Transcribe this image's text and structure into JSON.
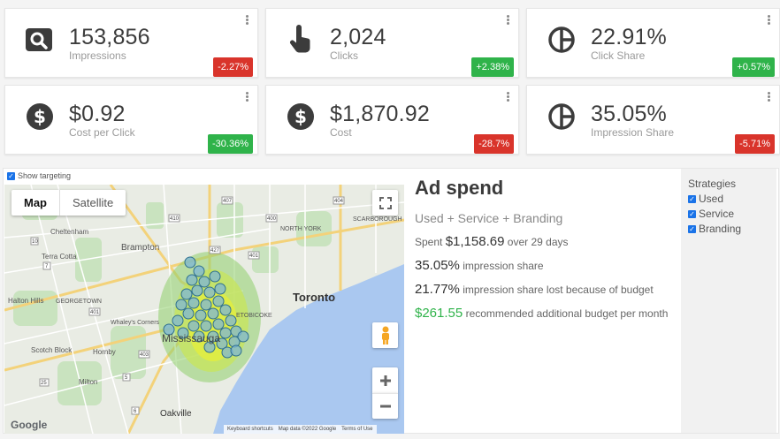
{
  "colors": {
    "negative": "#d9342b",
    "positive": "#2fb34a",
    "icon": "#3c3c3c",
    "water": "#aac8f0",
    "heat_inner": "#e3ee3d",
    "heat_outer": "#8fd06b",
    "bubble": "#7db6d6"
  },
  "metrics": [
    {
      "icon": "search-icon",
      "value": "153,856",
      "label": "Impressions",
      "change": "-2.27%",
      "trend": "negative"
    },
    {
      "icon": "pointer-hand-icon",
      "value": "2,024",
      "label": "Clicks",
      "change": "+2.38%",
      "trend": "positive"
    },
    {
      "icon": "pie-chart-icon",
      "value": "22.91%",
      "label": "Click Share",
      "change": "+0.57%",
      "trend": "positive"
    },
    {
      "icon": "dollar-icon",
      "value": "$0.92",
      "label": "Cost per Click",
      "change": "-30.36%",
      "trend": "positive"
    },
    {
      "icon": "dollar-icon",
      "value": "$1,870.92",
      "label": "Cost",
      "change": "-28.7%",
      "trend": "negative"
    },
    {
      "icon": "pie-chart-icon",
      "value": "35.05%",
      "label": "Impression Share",
      "change": "-5.71%",
      "trend": "negative"
    }
  ],
  "map": {
    "show_targeting_label": "Show targeting",
    "type_buttons": [
      "Map",
      "Satellite"
    ],
    "active_type": "Map",
    "places": [
      "Cheltenham",
      "Brampton",
      "Terra Cotta",
      "Halton Hills",
      "GEORGETOWN",
      "Toronto",
      "NORTH YORK",
      "SCARBOROUGH",
      "Mississauga",
      "Whaley's Corners",
      "Scotch Block",
      "Hornby",
      "Milton",
      "Oakville",
      "ETOBICOKE"
    ],
    "road_numbers": [
      "410",
      "401",
      "427",
      "400",
      "404",
      "407",
      "403",
      "401",
      "10",
      "7",
      "5",
      "25",
      "6"
    ],
    "footer": [
      "Keyboard shortcuts",
      "Map data ©2022 Google",
      "Terms of Use"
    ],
    "logo": "Google"
  },
  "ad_spend": {
    "title": "Ad spend",
    "subtitle": "Used + Service + Branding",
    "spent_prefix": "Spent",
    "spent_value": "$1,158.69",
    "spent_suffix": "over 29 days",
    "impression_share_value": "35.05%",
    "impression_share_label": "impression share",
    "lost_value": "21.77%",
    "lost_label": "impression share lost because of budget",
    "recommended_value": "$261.55",
    "recommended_label": "recommended additional budget per month"
  },
  "strategies": {
    "title": "Strategies",
    "items": [
      {
        "label": "Used",
        "checked": true
      },
      {
        "label": "Service",
        "checked": true
      },
      {
        "label": "Branding",
        "checked": true
      }
    ]
  }
}
